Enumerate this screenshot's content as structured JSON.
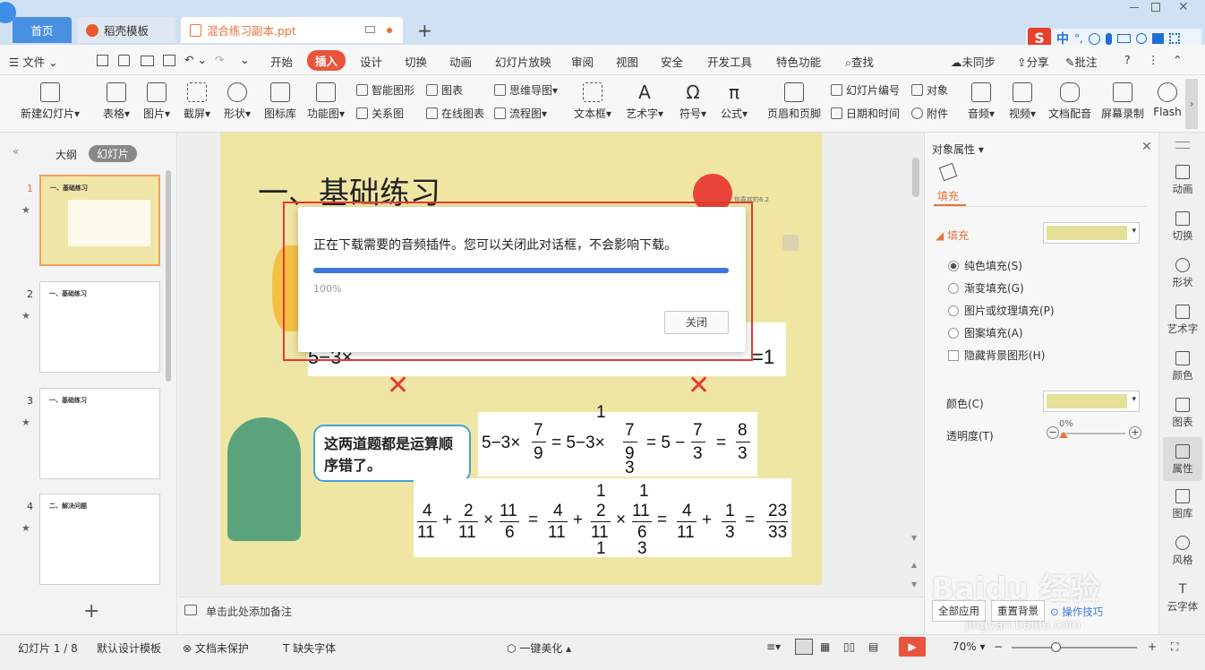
{
  "tabs": {
    "home": "首页",
    "template": "稻壳模板",
    "document": "混合练习副本.ppt",
    "add": "+"
  },
  "menu": {
    "file": "文件",
    "items": [
      "开始",
      "插入",
      "设计",
      "切换",
      "动画",
      "幻灯片放映",
      "审阅",
      "视图",
      "安全",
      "开发工具",
      "特色功能"
    ],
    "search": "查找",
    "sync": "未同步",
    "share": "分享",
    "comment": "批注",
    "help": "?"
  },
  "ribbon": {
    "new_slide": "新建幻灯片",
    "table": "表格",
    "picture": "图片",
    "screenshot": "截屏",
    "shape": "形状",
    "icon_lib": "图标库",
    "func_chart": "功能图",
    "smart_art": "智能图形",
    "chart": "图表",
    "mind_map": "思维导图",
    "relation": "关系图",
    "online_chart": "在线图表",
    "flow": "流程图",
    "textbox": "文本框",
    "art_text": "艺术字",
    "symbol": "符号",
    "formula": "公式",
    "header_footer": "页眉和页脚",
    "slide_num": "幻灯片编号",
    "object": "对象",
    "datetime": "日期和时间",
    "attachment": "附件",
    "audio": "音频",
    "video": "视频",
    "narration": "文档配音",
    "screen_rec": "屏幕录制",
    "flash": "Flash"
  },
  "leftpane": {
    "outline": "大纲",
    "slides": "幻灯片",
    "thumb_titles": [
      "一、基础练习",
      "一、基础练习",
      "一、基础练习",
      "二、解决问题"
    ],
    "numbers": [
      "1",
      "2",
      "3",
      "4"
    ],
    "add": "+"
  },
  "slide": {
    "title": "一、基础练习",
    "speech": "这两道题都是运算顺序错了。",
    "eq1": "5−3×",
    "eq_right_tail": "=1",
    "eq3": {
      "a": "5−3×",
      "n1": "7",
      "d1": "9",
      "b": "= 5−3×",
      "n2": "7",
      "d2": "9",
      "c": "= 5 −",
      "n3": "7",
      "d3": "3",
      "eq": "=",
      "n4": "8",
      "d4": "3",
      "top": "1",
      "bottom": "3"
    },
    "eq4": {
      "n1": "4",
      "d1": "11",
      "n2": "2",
      "d2": "11",
      "n3": "11",
      "d3": "6",
      "n4": "4",
      "d4": "11",
      "n5": "2",
      "d5": "11",
      "n6": "11",
      "d6": "6",
      "n7": "4",
      "d7": "11",
      "n8": "1",
      "d8": "3",
      "n9": "23",
      "d9": "33",
      "t1": "1",
      "t2": "1",
      "b1": "1",
      "b2": "3"
    },
    "small_label": "你喜欢的6.2"
  },
  "dialog": {
    "message": "正在下载需要的音频插件。您可以关闭此对话框，不会影响下载。",
    "progress_percent": 100,
    "progress_label": "100%",
    "close": "关闭"
  },
  "notes": {
    "placeholder": "单击此处添加备注"
  },
  "rightpanel": {
    "title": "对象属性",
    "tab": "填充",
    "section": "填充",
    "options": [
      "纯色填充(S)",
      "渐变填充(G)",
      "图片或纹理填充(P)",
      "图案填充(A)"
    ],
    "hide_bg": "隐藏背景图形(H)",
    "color_label": "颜色(C)",
    "transparency_label": "透明度(T)",
    "transparency_value": "0%",
    "apply_all": "全部应用",
    "reset_bg": "重置背景",
    "tips": "操作技巧",
    "fill_color": "#e6e09a"
  },
  "sidebar": [
    "动画",
    "切换",
    "形状",
    "艺术字",
    "颜色",
    "图表",
    "属性",
    "图库",
    "风格",
    "云字体"
  ],
  "status": {
    "slide_info": "幻灯片 1 / 8",
    "template": "默认设计模板",
    "doc_protect": "文档未保护",
    "font_missing": "缺失字体",
    "beautify": "一键美化",
    "zoom": "70%"
  },
  "watermark": {
    "brand": "Baidu 经验",
    "url": "jingyan.baidu.com"
  },
  "ime": {
    "label": "中"
  }
}
